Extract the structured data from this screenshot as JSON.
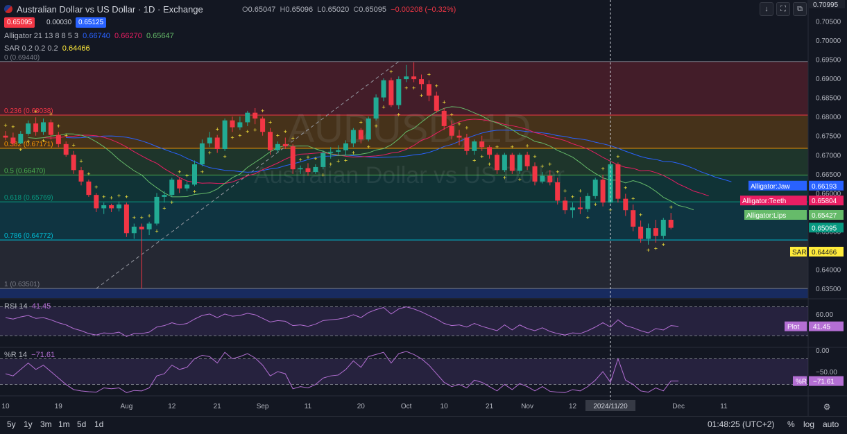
{
  "header": {
    "title": "Australian Dollar vs US Dollar · 1D · Exchange",
    "o_label": "O",
    "o": "0.65047",
    "h_label": "H",
    "h": "0.65096",
    "l_label": "L",
    "l": "0.65020",
    "c_label": "C",
    "c": "0.65095",
    "change": "−0.00208 (−0.32%)",
    "bid": "0.65095",
    "spread": "0.00030",
    "ask": "0.65125"
  },
  "indicators": {
    "alligator": {
      "label": "Alligator 21 13 8 8 5 3",
      "jaw": "0.66740",
      "teeth": "0.66270",
      "lips": "0.65647"
    },
    "sar": {
      "label": "SAR 0.2 0.2 0.2",
      "value": "0.64466"
    },
    "rsi": {
      "label": "RSI 14",
      "value": "41.45"
    },
    "wr": {
      "label": "%R 14",
      "value": "−71.61"
    }
  },
  "watermark": {
    "symbol": "AUDUSD, 1D",
    "name": "Australian Dollar vs US Dollar"
  },
  "colors": {
    "bg": "#131722",
    "up": "#22ab94",
    "down": "#f23645",
    "jaw": "#2962ff",
    "teeth": "#e91e63",
    "lips": "#66bb6a",
    "sar": "#ffeb3b",
    "osc": "#b46fd4"
  },
  "chart_data": [
    {
      "type": "candlestick",
      "title": "Australian Dollar vs US Dollar · 1D · Exchange",
      "ylim": [
        0.6325,
        0.7105
      ],
      "y_ticks": [
        "0.70995",
        "0.70500",
        "0.70000",
        "0.69500",
        "0.69000",
        "0.68500",
        "0.68000",
        "0.67500",
        "0.67000",
        "0.66500",
        "0.66000",
        "0.65500",
        "0.65000",
        "0.64500",
        "0.64000",
        "0.63500"
      ],
      "x_tick_labels": [
        "10",
        "19",
        "Aug",
        "12",
        "21",
        "Sep",
        "11",
        "20",
        "Oct",
        "10",
        "21",
        "Nov",
        "12",
        "2024/11/20",
        "Dec",
        "11"
      ],
      "x_tick_bars": [
        0,
        7,
        16,
        22,
        28,
        34,
        40,
        47,
        53,
        58,
        64,
        69,
        75,
        80,
        89,
        95
      ],
      "crosshair_bar": 80,
      "ohlc": [
        [
          0.675,
          0.6762,
          0.6738,
          0.6745
        ],
        [
          0.6745,
          0.6758,
          0.6722,
          0.673
        ],
        [
          0.673,
          0.6762,
          0.6728,
          0.6755
        ],
        [
          0.6755,
          0.679,
          0.675,
          0.6782
        ],
        [
          0.6782,
          0.6798,
          0.675,
          0.676
        ],
        [
          0.676,
          0.6795,
          0.6752,
          0.6785
        ],
        [
          0.6785,
          0.6792,
          0.674,
          0.6752
        ],
        [
          0.6752,
          0.676,
          0.672,
          0.6728
        ],
        [
          0.6728,
          0.6735,
          0.6695,
          0.67
        ],
        [
          0.67,
          0.671,
          0.665,
          0.666
        ],
        [
          0.666,
          0.6668,
          0.662,
          0.663
        ],
        [
          0.663,
          0.6635,
          0.659,
          0.6595
        ],
        [
          0.6595,
          0.66,
          0.655,
          0.656
        ],
        [
          0.656,
          0.6575,
          0.6545,
          0.6568
        ],
        [
          0.6568,
          0.6572,
          0.655,
          0.656
        ],
        [
          0.656,
          0.6578,
          0.6552,
          0.657
        ],
        [
          0.657,
          0.6575,
          0.6485,
          0.6495
        ],
        [
          0.6495,
          0.652,
          0.648,
          0.6512
        ],
        [
          0.6512,
          0.652,
          0.635,
          0.6505
        ],
        [
          0.6505,
          0.6525,
          0.649,
          0.652
        ],
        [
          0.652,
          0.66,
          0.6515,
          0.659
        ],
        [
          0.659,
          0.6605,
          0.6575,
          0.6595
        ],
        [
          0.6595,
          0.664,
          0.659,
          0.6635
        ],
        [
          0.6635,
          0.664,
          0.66,
          0.6612
        ],
        [
          0.6612,
          0.663,
          0.6605,
          0.6622
        ],
        [
          0.6622,
          0.6685,
          0.6618,
          0.6675
        ],
        [
          0.6675,
          0.674,
          0.667,
          0.673
        ],
        [
          0.673,
          0.676,
          0.672,
          0.6745
        ],
        [
          0.6745,
          0.6752,
          0.6705,
          0.6715
        ],
        [
          0.6715,
          0.6795,
          0.671,
          0.679
        ],
        [
          0.679,
          0.68,
          0.676,
          0.6772
        ],
        [
          0.6772,
          0.68,
          0.6765,
          0.6785
        ],
        [
          0.6785,
          0.6815,
          0.6775,
          0.681
        ],
        [
          0.681,
          0.6822,
          0.678,
          0.6795
        ],
        [
          0.6795,
          0.68,
          0.675,
          0.676
        ],
        [
          0.676,
          0.677,
          0.67,
          0.6712
        ],
        [
          0.6712,
          0.6735,
          0.6705,
          0.6728
        ],
        [
          0.6728,
          0.6745,
          0.6715,
          0.6722
        ],
        [
          0.6722,
          0.6728,
          0.665,
          0.6662
        ],
        [
          0.6662,
          0.6672,
          0.665,
          0.6665
        ],
        [
          0.6665,
          0.6678,
          0.6645,
          0.6655
        ],
        [
          0.6655,
          0.6675,
          0.665,
          0.6668
        ],
        [
          0.6668,
          0.6712,
          0.6662,
          0.6705
        ],
        [
          0.6705,
          0.672,
          0.669,
          0.6708
        ],
        [
          0.6708,
          0.6725,
          0.6698,
          0.6712
        ],
        [
          0.6712,
          0.6738,
          0.67,
          0.673
        ],
        [
          0.673,
          0.677,
          0.672,
          0.6765
        ],
        [
          0.6765,
          0.677,
          0.673,
          0.674
        ],
        [
          0.674,
          0.68,
          0.6735,
          0.6795
        ],
        [
          0.6795,
          0.6858,
          0.679,
          0.685
        ],
        [
          0.685,
          0.69,
          0.684,
          0.6895
        ],
        [
          0.6895,
          0.6902,
          0.6825,
          0.683
        ],
        [
          0.683,
          0.6905,
          0.682,
          0.6898
        ],
        [
          0.6898,
          0.6935,
          0.689,
          0.6905
        ],
        [
          0.6905,
          0.6942,
          0.689,
          0.6898
        ],
        [
          0.6898,
          0.691,
          0.687,
          0.6885
        ],
        [
          0.6885,
          0.6895,
          0.684,
          0.6855
        ],
        [
          0.6855,
          0.6865,
          0.681,
          0.6815
        ],
        [
          0.6815,
          0.6822,
          0.6765,
          0.6775
        ],
        [
          0.6775,
          0.679,
          0.674,
          0.675
        ],
        [
          0.675,
          0.6765,
          0.6725,
          0.6745
        ],
        [
          0.6745,
          0.6755,
          0.67,
          0.671
        ],
        [
          0.671,
          0.674,
          0.67,
          0.6735
        ],
        [
          0.6735,
          0.675,
          0.671,
          0.672
        ],
        [
          0.672,
          0.6725,
          0.669,
          0.67
        ],
        [
          0.67,
          0.6705,
          0.665,
          0.666
        ],
        [
          0.666,
          0.6705,
          0.6655,
          0.67
        ],
        [
          0.67,
          0.6705,
          0.665,
          0.6658
        ],
        [
          0.6658,
          0.6705,
          0.665,
          0.67
        ],
        [
          0.67,
          0.6708,
          0.666,
          0.667
        ],
        [
          0.667,
          0.668,
          0.662,
          0.663
        ],
        [
          0.663,
          0.6655,
          0.6625,
          0.6645
        ],
        [
          0.6645,
          0.666,
          0.662,
          0.6628
        ],
        [
          0.6628,
          0.664,
          0.657,
          0.658
        ],
        [
          0.658,
          0.659,
          0.6545,
          0.6555
        ],
        [
          0.6555,
          0.6575,
          0.6535,
          0.6562
        ],
        [
          0.6562,
          0.659,
          0.6545,
          0.6558
        ],
        [
          0.6558,
          0.66,
          0.655,
          0.6592
        ],
        [
          0.6592,
          0.664,
          0.6585,
          0.6635
        ],
        [
          0.6635,
          0.6648,
          0.6565,
          0.6575
        ],
        [
          0.6575,
          0.6685,
          0.657,
          0.6675
        ],
        [
          0.6675,
          0.668,
          0.6575,
          0.6585
        ],
        [
          0.6585,
          0.6598,
          0.654,
          0.6555
        ],
        [
          0.6555,
          0.657,
          0.65,
          0.6512
        ],
        [
          0.6512,
          0.6528,
          0.647,
          0.648
        ],
        [
          0.648,
          0.652,
          0.6465,
          0.6508
        ],
        [
          0.6508,
          0.653,
          0.647,
          0.6488
        ],
        [
          0.6488,
          0.6535,
          0.648,
          0.653
        ],
        [
          0.653,
          0.6548,
          0.6505,
          0.6509
        ]
      ],
      "fibonacci": {
        "high": 0.6944,
        "low": 0.63501,
        "levels": [
          {
            "label": "0 (0.69440)",
            "price": 0.6944,
            "color": "#787b86"
          },
          {
            "label": "0.236 (0.68038)",
            "price": 0.68038,
            "color": "#f23645"
          },
          {
            "label": "0.382 (0.67171)",
            "price": 0.67171,
            "color": "#ff9800"
          },
          {
            "label": "0.5 (0.66470)",
            "price": 0.6647,
            "color": "#4caf50"
          },
          {
            "label": "0.618 (0.65769)",
            "price": 0.65769,
            "color": "#089981"
          },
          {
            "label": "0.786 (0.64772)",
            "price": 0.64772,
            "color": "#00bcd4"
          },
          {
            "label": "1 (0.63501)",
            "price": 0.63501,
            "color": "#787b86"
          }
        ]
      },
      "labels": [
        {
          "text": "Alligator:Jaw",
          "value": "0.66193",
          "price": 0.66193,
          "color": "#2962ff"
        },
        {
          "text": "Alligator:Teeth",
          "value": "0.65804",
          "price": 0.65804,
          "color": "#e91e63"
        },
        {
          "text": "Alligator:Lips",
          "value": "0.65427",
          "price": 0.65427,
          "color": "#66bb6a"
        },
        {
          "text": "",
          "value": "0.65095",
          "price": 0.65095,
          "color": "#089981"
        },
        {
          "text": "SAR",
          "value": "0.64466",
          "price": 0.64466,
          "color": "#ffeb3b"
        }
      ]
    },
    {
      "type": "line",
      "title": "RSI 14",
      "ylim": [
        15,
        80
      ],
      "y_ticks": [
        "60.00"
      ],
      "bands": [
        30,
        70
      ],
      "labels": [
        {
          "text": "Plot",
          "value": "41.45"
        }
      ],
      "values": [
        55,
        53,
        56,
        58,
        54,
        55,
        52,
        48,
        45,
        40,
        37,
        33,
        31,
        34,
        33,
        35,
        29,
        33,
        33,
        35,
        42,
        44,
        48,
        45,
        47,
        53,
        58,
        60,
        55,
        60,
        57,
        58,
        61,
        59,
        54,
        49,
        51,
        50,
        44,
        45,
        43,
        46,
        51,
        52,
        53,
        55,
        59,
        55,
        62,
        66,
        69,
        60,
        67,
        70,
        67,
        63,
        58,
        53,
        47,
        44,
        45,
        42,
        47,
        43,
        40,
        37,
        45,
        38,
        45,
        40,
        37,
        41,
        36,
        33,
        31,
        34,
        33,
        37,
        42,
        48,
        42,
        52,
        44,
        41,
        37,
        34,
        40,
        38,
        44,
        43
      ]
    },
    {
      "type": "line",
      "title": "%R 14",
      "ylim": [
        -105,
        5
      ],
      "y_ticks": [
        "0.00",
        "−50.00"
      ],
      "bands": [
        -20,
        -80
      ],
      "labels": [
        {
          "text": "%R",
          "value": "−71.61"
        }
      ],
      "values": [
        -55,
        -60,
        -45,
        -30,
        -45,
        -35,
        -50,
        -65,
        -80,
        -92,
        -95,
        -97,
        -98,
        -88,
        -90,
        -88,
        -99,
        -94,
        -95,
        -88,
        -60,
        -55,
        -35,
        -45,
        -40,
        -20,
        -12,
        -15,
        -30,
        -5,
        -20,
        -15,
        -8,
        -18,
        -35,
        -60,
        -50,
        -55,
        -90,
        -85,
        -88,
        -80,
        -65,
        -60,
        -58,
        -45,
        -25,
        -40,
        -15,
        -10,
        -5,
        -30,
        -8,
        -3,
        -10,
        -20,
        -35,
        -55,
        -75,
        -85,
        -80,
        -88,
        -70,
        -75,
        -85,
        -95,
        -80,
        -92,
        -78,
        -85,
        -95,
        -85,
        -96,
        -98,
        -99,
        -92,
        -95,
        -85,
        -70,
        -50,
        -75,
        -20,
        -70,
        -80,
        -95,
        -98,
        -88,
        -95,
        -72,
        -72
      ]
    }
  ],
  "xaxis_labels": [
    "10",
    "19",
    "Aug",
    "12",
    "21",
    "Sep",
    "11",
    "20",
    "Oct",
    "10",
    "21",
    "Nov",
    "12",
    "Dec",
    "11"
  ],
  "crosshair_date": "2024/11/20",
  "price_axis_top": "0.70995",
  "bottombar": {
    "ranges": [
      "5y",
      "1y",
      "3m",
      "1m",
      "5d",
      "1d"
    ],
    "time": "01:48:25 (UTC+2)",
    "percent": "%",
    "log": "log",
    "auto": "auto"
  }
}
